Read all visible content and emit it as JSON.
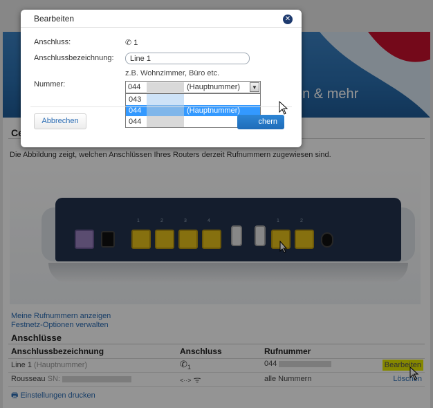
{
  "dialog": {
    "title": "Bearbeiten",
    "close_icon": "close-icon",
    "fields": {
      "connection_label": "Anschluss:",
      "connection_value": "1",
      "connection_icon": "phone-icon",
      "name_label": "Anschlussbezeichnung:",
      "name_value": "Line 1",
      "hint": "z.B. Wohnzimmer, Büro etc.",
      "number_label": "Nummer:",
      "number_selected_prefix": "044",
      "number_selected_suffix": "(Hauptnummer)"
    },
    "dropdown_options": [
      {
        "prefix": "043",
        "suffix": ""
      },
      {
        "prefix": "044",
        "suffix": "(Hauptnummer)",
        "selected": true
      },
      {
        "prefix": "044",
        "suffix": ""
      }
    ],
    "buttons": {
      "cancel": "Abbrechen",
      "save_partial": "chern"
    }
  },
  "background": {
    "banner_text": "en & mehr",
    "section_title": "Ce",
    "intro": "Die Abbildung zeigt, welchen Anschlüssen Ihres Routers derzeit Rufnummern zugewiesen sind.",
    "port_labels": [
      "1",
      "2",
      "<··>",
      "1",
      "2",
      "3",
      "4",
      "1",
      "2",
      "~"
    ],
    "links": [
      "Meine Rufnummern anzeigen",
      "Festnetz-Optionen verwalten"
    ],
    "table_title": "Anschlüsse",
    "table": {
      "headers": [
        "Anschlussbezeichnung",
        "Anschluss",
        "Rufnummer"
      ],
      "rows": [
        {
          "name": "Line 1",
          "note": "(Hauptnummer)",
          "connection_icon": "phone-icon",
          "connection_text": "1",
          "number": "044",
          "action": "Bearbeiten"
        },
        {
          "name": "Rousseau",
          "note": "SN:",
          "connection_icon": "lan-wifi-icon",
          "connection_text": "<··>",
          "number": "alle Nummern",
          "action": "Löschen"
        }
      ]
    },
    "print_label": "Einstellungen drucken",
    "print_icon": "printer-icon"
  },
  "colors": {
    "accent": "#2a6cb4",
    "banner": "#2a6fb0",
    "selected": "#3399ff",
    "highlight": "#e5e800"
  }
}
